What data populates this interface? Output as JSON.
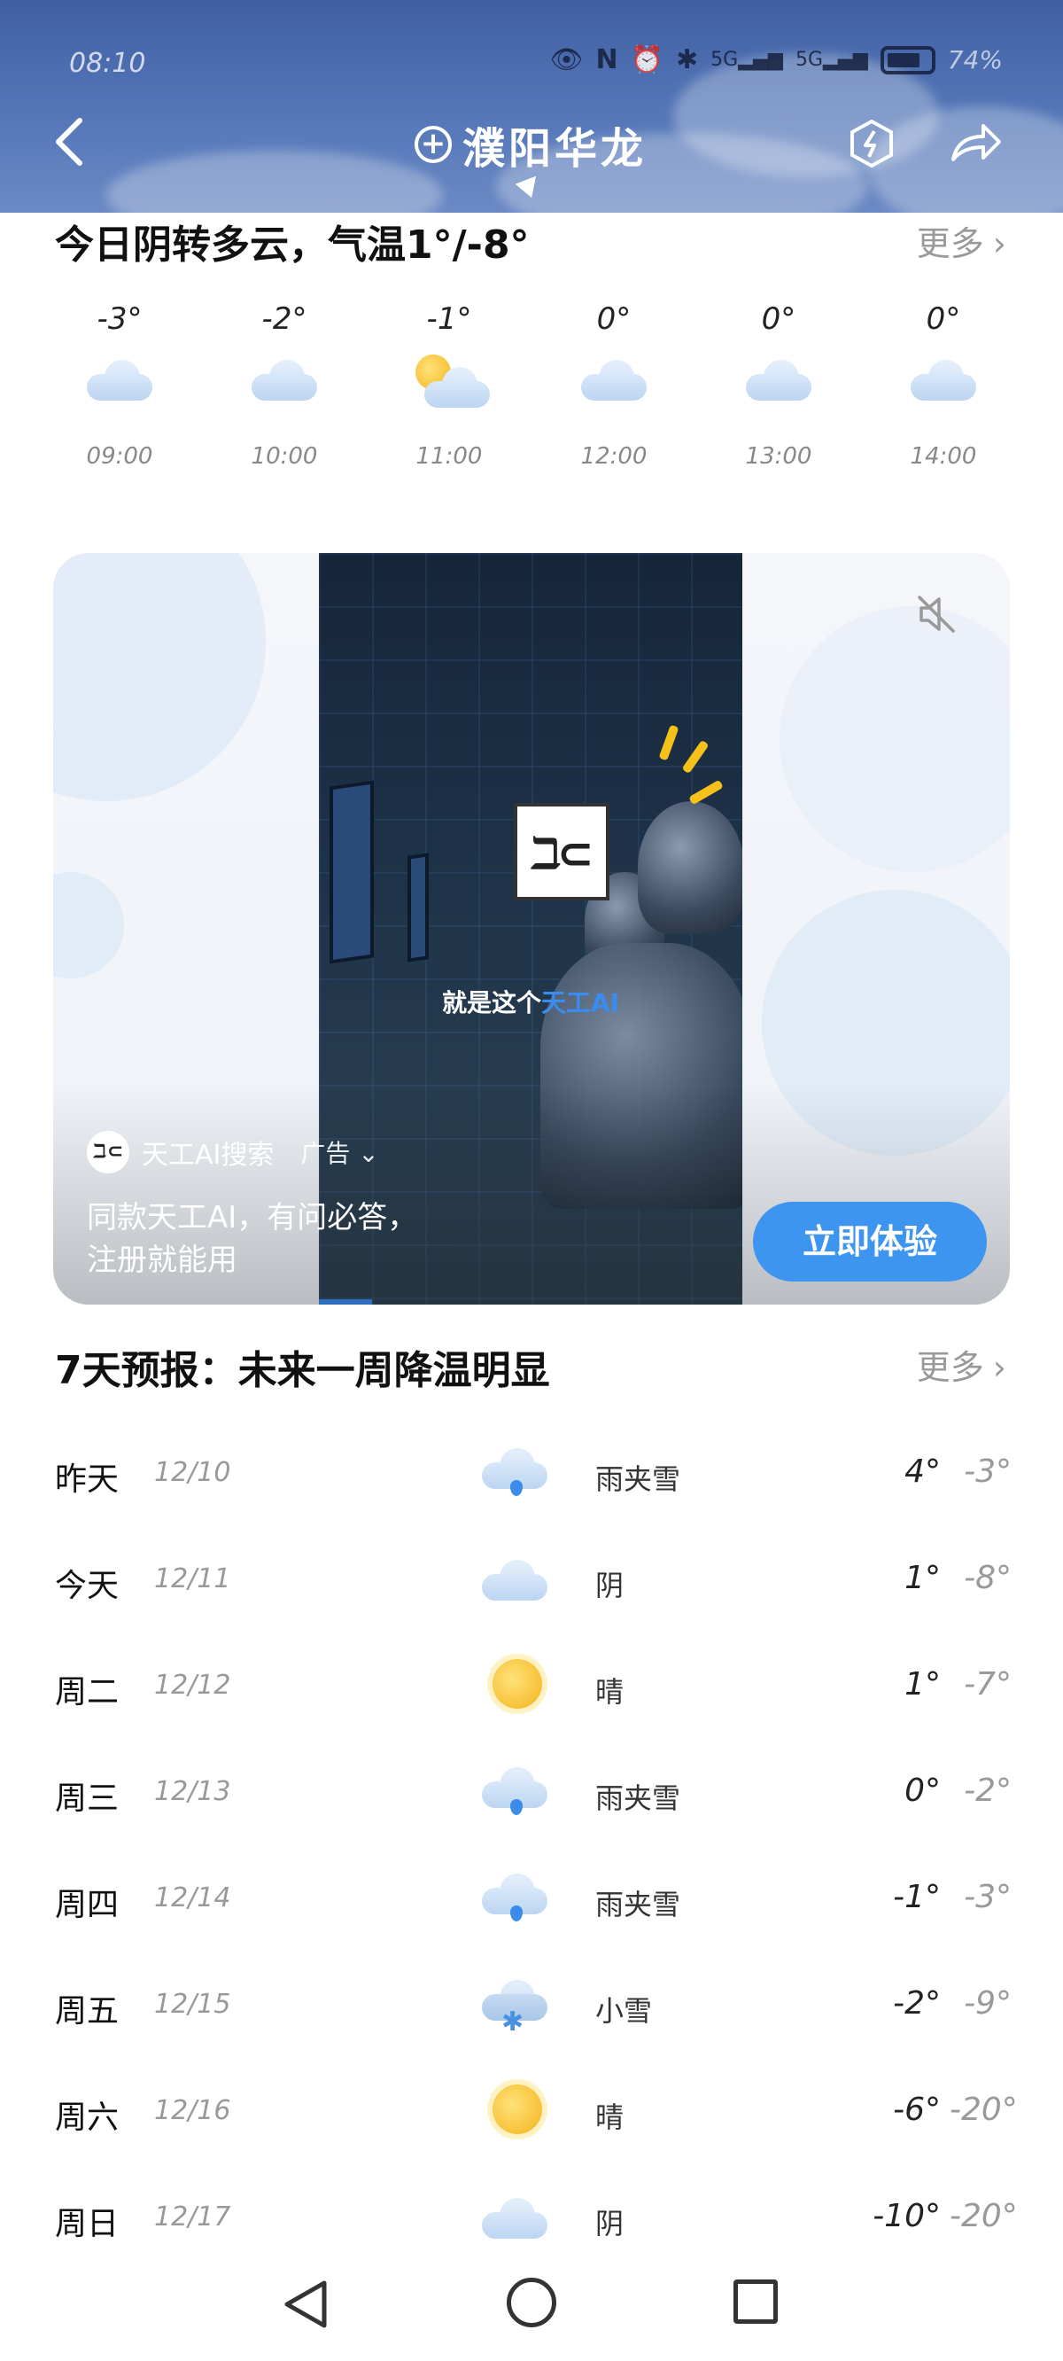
{
  "status_bar": {
    "time": "08:10",
    "battery": "74%",
    "signal_1": "5G",
    "signal_2": "5G"
  },
  "header": {
    "city": "濮阳华龙"
  },
  "today": {
    "summary": "今日阴转多云，气温1°/-8°",
    "more_label": "更多",
    "hourly": [
      {
        "temp": "-3°",
        "time": "09:00",
        "icon": "cloud-icon"
      },
      {
        "temp": "-2°",
        "time": "10:00",
        "icon": "cloud-icon"
      },
      {
        "temp": "-1°",
        "time": "11:00",
        "icon": "partly-sunny-icon"
      },
      {
        "temp": "0°",
        "time": "12:00",
        "icon": "cloud-icon"
      },
      {
        "temp": "0°",
        "time": "13:00",
        "icon": "cloud-icon"
      },
      {
        "temp": "0°",
        "time": "14:00",
        "icon": "cloud-icon"
      }
    ]
  },
  "ad": {
    "video_caption_prefix": "就是这个",
    "video_caption_highlight": "天工AI",
    "brand_name": "天工AI搜索",
    "tag_label": "广告",
    "description": "同款天工AI，有问必答，注册就能用",
    "cta_label": "立即体验",
    "logo_glyph": "ℶ⊂"
  },
  "week": {
    "title": "7天预报：未来一周降温明显",
    "more_label": "更多",
    "days": [
      {
        "name": "昨天",
        "date": "12/10",
        "cond": "雨夹雪",
        "high": "4°",
        "low": "-3°",
        "icon": "sleet-icon"
      },
      {
        "name": "今天",
        "date": "12/11",
        "cond": "阴",
        "high": "1°",
        "low": "-8°",
        "icon": "cloud-icon"
      },
      {
        "name": "周二",
        "date": "12/12",
        "cond": "晴",
        "high": "1°",
        "low": "-7°",
        "icon": "sun-icon"
      },
      {
        "name": "周三",
        "date": "12/13",
        "cond": "雨夹雪",
        "high": "0°",
        "low": "-2°",
        "icon": "sleet-icon"
      },
      {
        "name": "周四",
        "date": "12/14",
        "cond": "雨夹雪",
        "high": "-1°",
        "low": "-3°",
        "icon": "sleet-icon"
      },
      {
        "name": "周五",
        "date": "12/15",
        "cond": "小雪",
        "high": "-2°",
        "low": "-9°",
        "icon": "snow-icon"
      },
      {
        "name": "周六",
        "date": "12/16",
        "cond": "晴",
        "high": "-6°",
        "low": "-20°",
        "icon": "sun-icon"
      },
      {
        "name": "周日",
        "date": "12/17",
        "cond": "阴",
        "high": "-10°",
        "low": "-20°",
        "icon": "cloud-icon"
      }
    ]
  },
  "colors": {
    "header_blue": "#4a6bb0",
    "cta_blue": "#3e95f0",
    "sun_yellow": "#f4b31a",
    "rain_blue": "#3b8ce8"
  }
}
